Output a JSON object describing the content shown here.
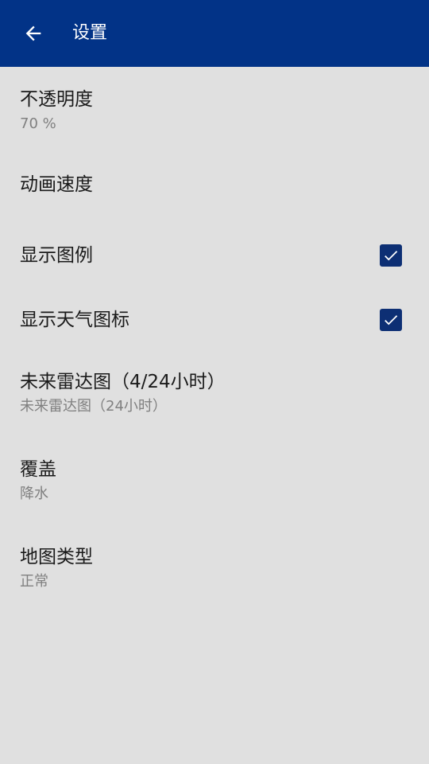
{
  "app_bar": {
    "title": "设置",
    "back_icon": "arrow-left-icon"
  },
  "colors": {
    "app_bar": "#023387",
    "background": "#e0e0e0",
    "checkbox": "#0d2f74"
  },
  "preferences": [
    {
      "title": "不透明度",
      "summary": "70 %"
    },
    {
      "title": "动画速度"
    },
    {
      "title": "显示图例",
      "checked": true
    },
    {
      "title": "显示天气图标",
      "checked": true
    },
    {
      "title": "未来雷达图（4/24小时）",
      "summary": "未来雷达图（24小时）"
    },
    {
      "title": "覆盖",
      "summary": "降水"
    },
    {
      "title": "地图类型",
      "summary": "正常"
    }
  ]
}
